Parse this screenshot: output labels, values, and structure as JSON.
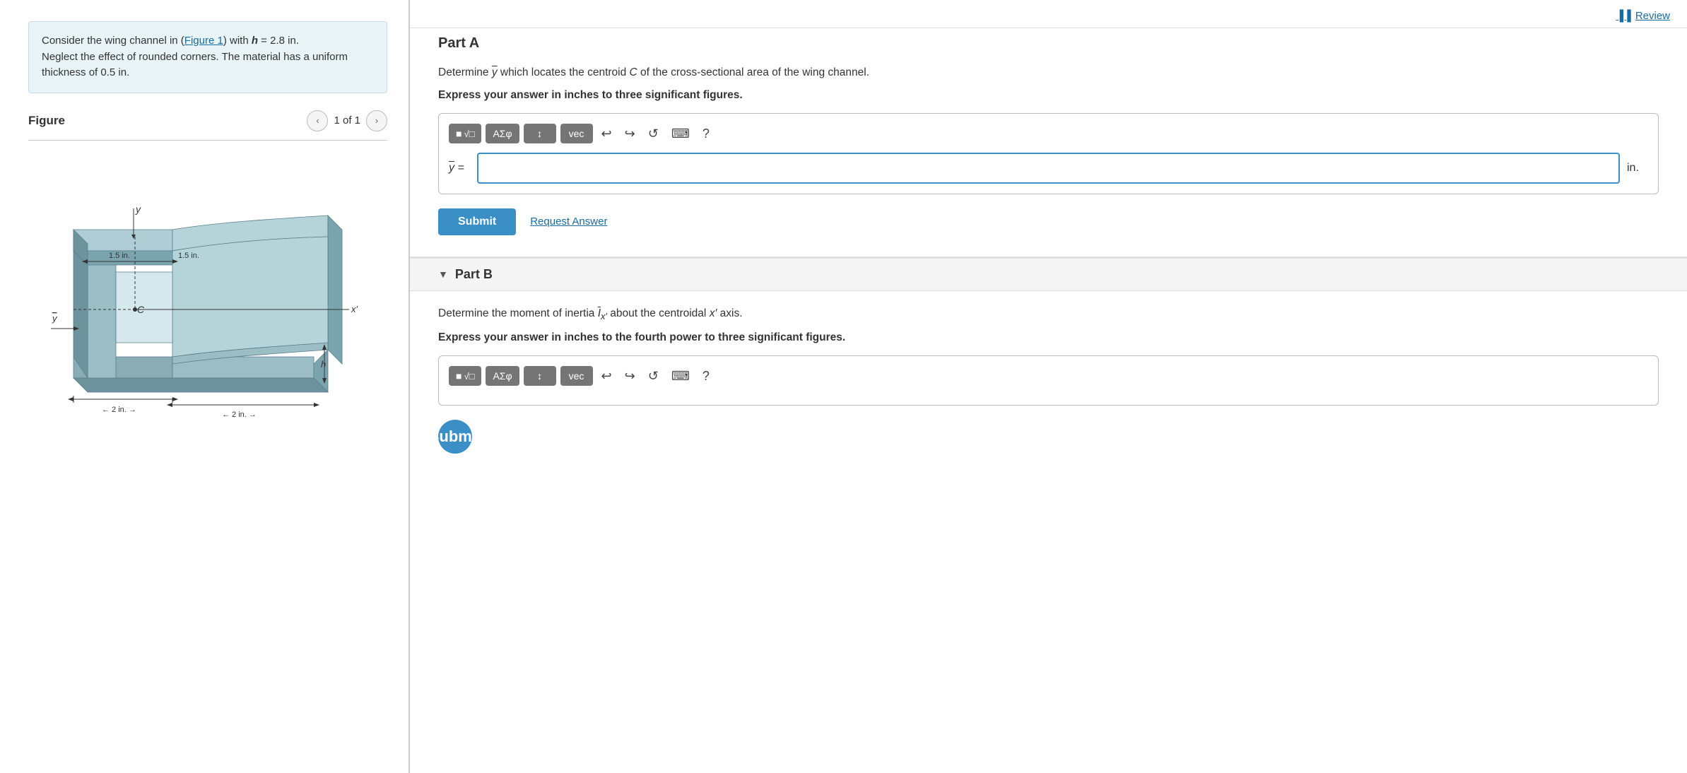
{
  "left": {
    "problem_text_1": "Consider the wing channel in (",
    "figure_link": "Figure 1",
    "problem_text_2": ") with ",
    "problem_h_var": "h",
    "problem_text_3": " = 2.8 in.",
    "problem_text_4": "Neglect the effect of rounded corners. The material has a uniform thickness of 0.5 in.",
    "figure_label": "Figure",
    "nav_prev": "‹",
    "nav_next": "›",
    "nav_count": "1 of 1",
    "dim1": "1.5 in.",
    "dim2": "1.5 in.",
    "dim3": "2 in.",
    "dim4": "2 in.",
    "label_y": "y",
    "label_C": "C",
    "label_ybar": "ȳ",
    "label_x_prime": "x′",
    "label_h": "h"
  },
  "right": {
    "review_label": "Review",
    "part_a_title": "Part A",
    "part_a_question": "Determine ȳ which locates the centroid C of the cross-sectional area of the wing channel.",
    "part_a_bold": "Express your answer in inches to three significant figures.",
    "answer_label": "ȳ =",
    "answer_unit": "in.",
    "toolbar": {
      "btn1": "√□",
      "btn2": "AΣφ",
      "btn3": "↕",
      "btn4": "vec",
      "undo": "↩",
      "redo": "↪",
      "refresh": "↺",
      "keyboard": "⌨",
      "help": "?"
    },
    "submit_label": "Submit",
    "request_answer_label": "Request Answer",
    "part_b_header": "Part B",
    "part_b_question_1": "Determine the moment of inertia ",
    "part_b_I_var": "Ī",
    "part_b_question_2": " about the centroidal ",
    "part_b_x_var": "x′",
    "part_b_question_3": " axis.",
    "part_b_bold": "Express your answer in inches to the fourth power to three significant figures.",
    "toolbar_b": {
      "btn1": "√□",
      "btn2": "AΣφ",
      "btn3": "↕",
      "btn4": "vec",
      "undo": "↩",
      "redo": "↪",
      "refresh": "↺",
      "keyboard": "⌨",
      "help": "?"
    }
  }
}
